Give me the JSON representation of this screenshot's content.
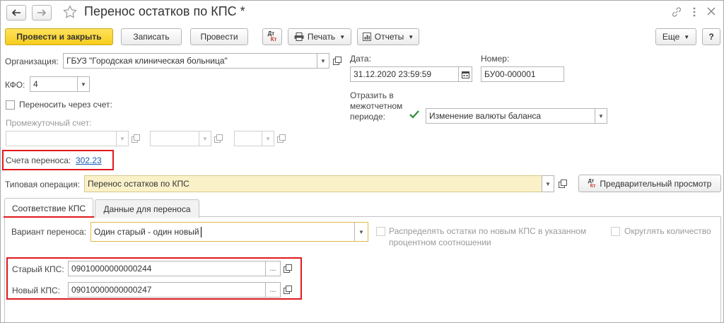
{
  "window": {
    "title": "Перенос остатков по КПС *"
  },
  "toolbar": {
    "post_close": "Провести и закрыть",
    "save": "Записать",
    "post": "Провести",
    "print": "Печать",
    "reports": "Отчеты",
    "more": "Еще",
    "help": "?"
  },
  "form": {
    "org_label": "Организация:",
    "org_value": "ГБУЗ \"Городская клиническая больница\"",
    "kfo_label": "КФО:",
    "kfo_value": "4",
    "transfer_via_label": "Переносить через счет:",
    "intermediate_label": "Промежуточный счет:",
    "date_label": "Дата:",
    "date_value": "31.12.2020 23:59:59",
    "number_label": "Номер:",
    "number_value": "БУ00-000001",
    "reflect_line1": "Отразить в",
    "reflect_line2": "межотчетном",
    "reflect_line3": "периоде:",
    "reflect_value": "Изменение валюты баланса",
    "accounts_label": "Счета переноса:",
    "accounts_value": "302.23",
    "typical_op_label": "Типовая операция:",
    "typical_op_value": "Перенос остатков по КПС",
    "preview_label": "Предварительный просмотр"
  },
  "tabs": [
    {
      "label": "Соответствие КПС"
    },
    {
      "label": "Данные для переноса"
    }
  ],
  "tab_content": {
    "variant_label": "Вариант переноса:",
    "variant_value": "Один старый - один новый",
    "distribute_line1": "Распределять остатки по новым КПС в указанном",
    "distribute_line2": "процентном соотношении",
    "round_label": "Округлять количество",
    "old_kps_label": "Старый КПС:",
    "old_kps_value": "09010000000000244",
    "new_kps_label": "Новый КПС:",
    "new_kps_value": "09010000000000247",
    "ellipsis": "..."
  },
  "colors": {
    "accent_yellow": "#f6cc1d",
    "highlight_red": "#e0191e",
    "link_blue": "#1a5fb4"
  }
}
